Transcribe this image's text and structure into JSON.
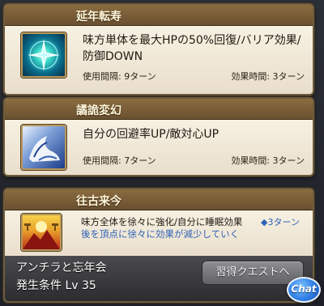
{
  "skills": [
    {
      "title": "延年転寿",
      "icon": "sparkle-star-icon",
      "description_line1": "味方単体を最大HPの50%回復/バリア効果/",
      "description_line2": "防御DOWN",
      "cooldown_label": "使用間隔: 9ターン",
      "duration_label": "効果時間: 3ターン"
    },
    {
      "title": "譎詭変幻",
      "icon": "evasion-shoe-icon",
      "description": "自分の回避率UP/敵対心UP",
      "cooldown_label": "使用間隔: 7ターン",
      "duration_label": "効果時間: 3ターン"
    },
    {
      "title": "往古来今",
      "icon": "sunset-mountain-icon",
      "description_line1": "味方全体を徐々に強化/自分に睡眠効果",
      "turns_label": "◆3ターン",
      "description_line2": "後を頂点に徐々に効果が減少していく",
      "quest_name": "アンチラと忘年会",
      "condition": "発生条件 Lv 35",
      "quest_button": "習得クエストへ"
    }
  ],
  "chat_button": "Chat",
  "colors": {
    "header_gold": "#7a5e36",
    "card_cream": "#f3ecdc",
    "accent_blue": "#2f63b8"
  }
}
